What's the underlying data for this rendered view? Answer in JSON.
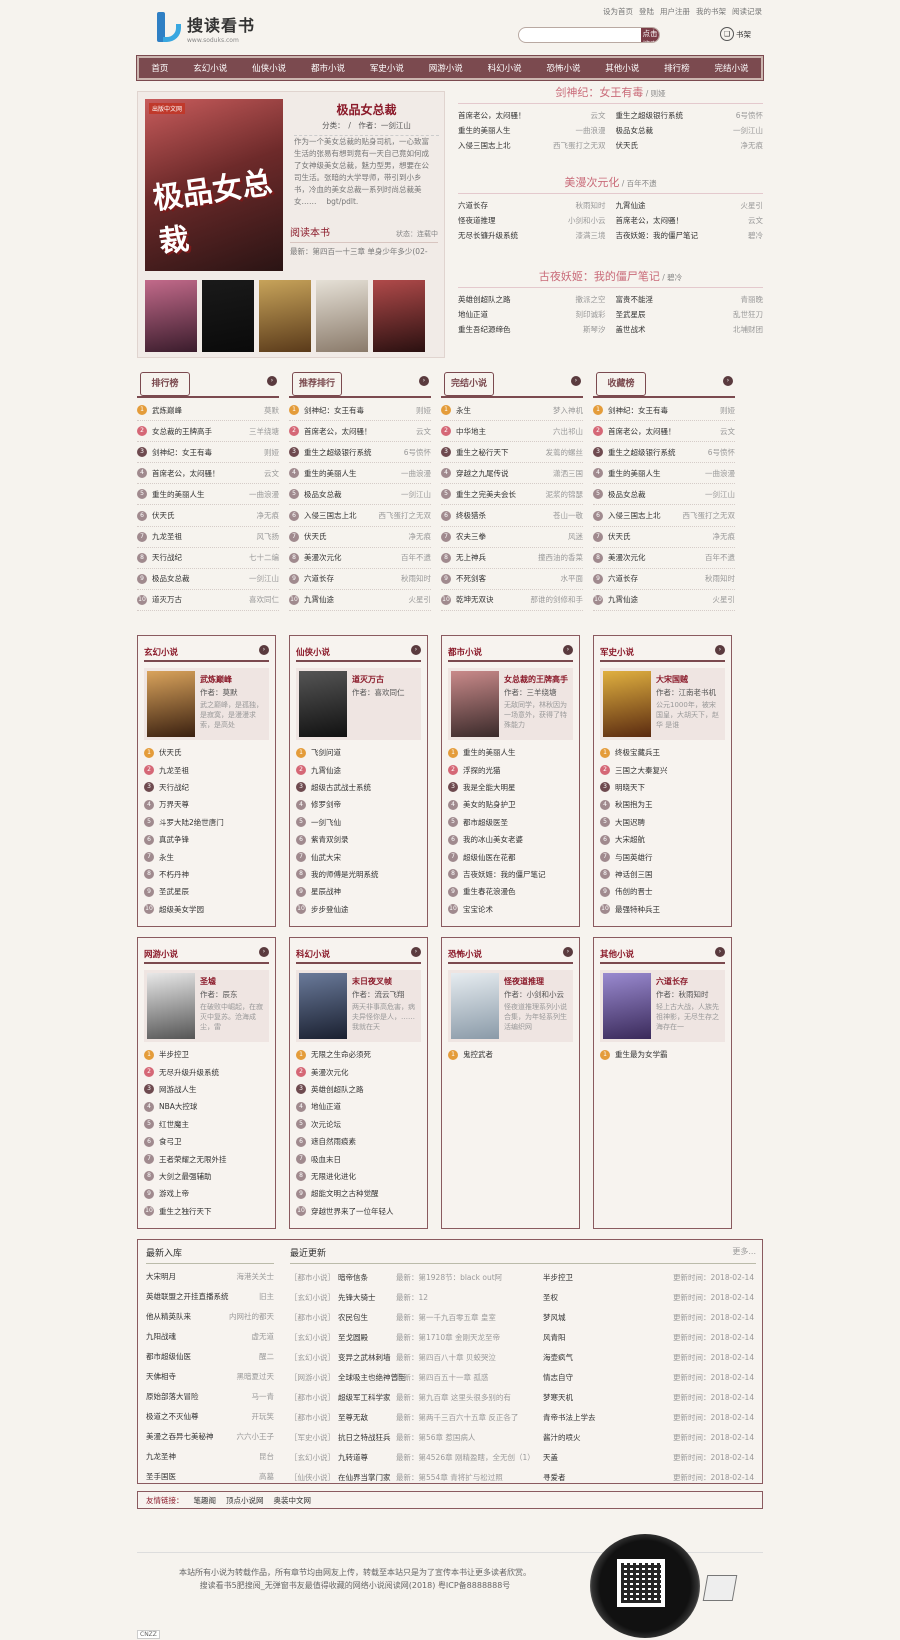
{
  "header": {
    "logo_title": "搜读看书",
    "logo_url_text": "www.soduks.com",
    "top_links": [
      "设为首页",
      "登陆",
      "用户注册",
      "我的书架",
      "阅读记录"
    ],
    "search_placeholder": "",
    "search_button": "点击搜索",
    "shelf_label": "书架"
  },
  "nav": [
    "首页",
    "玄幻小说",
    "仙侠小说",
    "都市小说",
    "军史小说",
    "网游小说",
    "科幻小说",
    "恐怖小说",
    "其他小说",
    "排行榜",
    "完结小说"
  ],
  "feature": {
    "cover_title": "极品女总裁",
    "cover_badge": "出版中文网",
    "title": "极品女总裁",
    "meta": "分类：　/　作者：一剑江山",
    "desc": "作为一个美女总裁的贴身司机，一心致富生活的张易有想到竟有一天自己竟如何成了女神级美女总裁，魅力型男，想要在公司生活。张暗的大学导师，带引到小乡书，冷血的美女总裁一系列时尚总裁美女…… 　bgt/pdlt.",
    "read": "阅读本书",
    "status": "状态：连载中",
    "latest": "最新：第四百一十三章 单身少年多少(02-"
  },
  "thumbs": [
    {
      "c1": "#c26a8a",
      "c2": "#3a1c2c"
    },
    {
      "c1": "#1a1a1a",
      "c2": "#0a0a0a"
    },
    {
      "c1": "#c7a35a",
      "c2": "#5a3a1a"
    },
    {
      "c1": "#e5e0d6",
      "c2": "#8a7a6a"
    },
    {
      "c1": "#b04a4a",
      "c2": "#2a1010"
    }
  ],
  "rec": [
    {
      "title": "剑神纪：女王有毒",
      "author": "则娅",
      "items": [
        [
          "首席老公，太闷骚！",
          "云文"
        ],
        [
          "重生之超级银行系统",
          "6号愤怀"
        ],
        [
          "重生的美丽人生",
          "一曲浪漫"
        ],
        [
          "极品女总裁",
          "一剑江山"
        ],
        [
          "入侵三国志上北",
          "西飞蛋打之无双"
        ],
        [
          "伏天氏",
          "净无痕"
        ]
      ]
    },
    {
      "title": "美漫次元化",
      "author": "百年不遗",
      "items": [
        [
          "六道长存",
          "秋雨知时"
        ],
        [
          "九霄仙途",
          "火星引"
        ],
        [
          "怪夜道推理",
          "小剑和小云"
        ],
        [
          "首席老公，太闷骚！",
          "云文"
        ],
        [
          "无尽长镰升级系统",
          "漆满三境"
        ],
        [
          "吉夜妖姬：我的僵尸笔记",
          "碧冷"
        ]
      ]
    },
    {
      "title": "古夜妖姬：我的僵尸笔记",
      "author": "碧冷",
      "items": [
        [
          "英雄创超队之路",
          "撒派之空"
        ],
        [
          "富贵不能淫",
          "青丽晚"
        ],
        [
          "地仙正道",
          "刻印诚彩"
        ],
        [
          "圣武星辰",
          "乱世狂刀"
        ],
        [
          "重生吾纪源缔色",
          "斯琴汐"
        ],
        [
          "盖世战术",
          "北埔财团"
        ]
      ]
    }
  ],
  "ranks": [
    {
      "title": "排行榜",
      "items": [
        [
          "武炼巅峰",
          "莫默"
        ],
        [
          "女总裁的王牌高手",
          "三羊绕塘"
        ],
        [
          "剑神纪：女王有毒",
          "则娅"
        ],
        [
          "首席老公，太闷骚！",
          "云文"
        ],
        [
          "重生的美丽人生",
          "一曲浪漫"
        ],
        [
          "伏天氏",
          "净无痕"
        ],
        [
          "九龙圣祖",
          "风飞扬"
        ],
        [
          "天行战纪",
          "七十二编"
        ],
        [
          "极品女总裁",
          "一剑江山"
        ],
        [
          "道灭万古",
          "喜欢同仁"
        ]
      ]
    },
    {
      "title": "推荐排行",
      "items": [
        [
          "剑神纪：女王有毒",
          "则娅"
        ],
        [
          "首席老公，太闷骚！",
          "云文"
        ],
        [
          "重生之超级银行系统",
          "6号愤怀"
        ],
        [
          "重生的美丽人生",
          "一曲浪漫"
        ],
        [
          "极品女总裁",
          "一剑江山"
        ],
        [
          "入侵三国志上北",
          "西飞蛋打之无双"
        ],
        [
          "伏天氏",
          "净无痕"
        ],
        [
          "美漫次元化",
          "百年不遗"
        ],
        [
          "六道长存",
          "秋雨知时"
        ],
        [
          "九霄仙途",
          "火星引"
        ]
      ]
    },
    {
      "title": "完结小说",
      "items": [
        [
          "永生",
          "梦入神机"
        ],
        [
          "中华地主",
          "六出祁山"
        ],
        [
          "重生之秘行天下",
          "发蔫的螺丝"
        ],
        [
          "穿越之九尾传说",
          "潇洒三国"
        ],
        [
          "重生之完美夫会长",
          "泥浆的锦瑟"
        ],
        [
          "终极猎杀",
          "苍山一敬"
        ],
        [
          "农夫三拳",
          "风迷"
        ],
        [
          "无上神兵",
          "撞西油的香菜"
        ],
        [
          "不死剑客",
          "水平面"
        ],
        [
          "乾坤无双诀",
          "那谁的剑修和手"
        ]
      ]
    },
    {
      "title": "收藏榜",
      "items": [
        [
          "剑神纪：女王有毒",
          "则娅"
        ],
        [
          "首席老公，太闷骚！",
          "云文"
        ],
        [
          "重生之超级银行系统",
          "6号愤怀"
        ],
        [
          "重生的美丽人生",
          "一曲浪漫"
        ],
        [
          "极品女总裁",
          "一剑江山"
        ],
        [
          "入侵三国志上北",
          "西飞蛋打之无双"
        ],
        [
          "伏天氏",
          "净无痕"
        ],
        [
          "美漫次元化",
          "百年不遗"
        ],
        [
          "六道长存",
          "秋雨知时"
        ],
        [
          "九霄仙途",
          "火星引"
        ]
      ]
    }
  ],
  "cats": [
    {
      "title": "玄幻小说",
      "top": {
        "name": "武炼巅峰",
        "author": "作者：莫默",
        "desc": "武之巅峰，是孤独，是寂寞，是漫漫求索，是高处",
        "c1": "#d9a35c",
        "c2": "#3a2010"
      },
      "items": [
        "伏天氏",
        "九龙圣祖",
        "天行战纪",
        "万界天尊",
        "斗罗大陆2绝世唐门",
        "真武争锋",
        "永生",
        "不朽丹神",
        "圣武星辰",
        "超级美女学园"
      ]
    },
    {
      "title": "仙侠小说",
      "top": {
        "name": "道灭万古",
        "author": "作者：喜欢同仁",
        "desc": "",
        "c1": "#555",
        "c2": "#111"
      },
      "items": [
        "飞剑问道",
        "九霄仙途",
        "超级古武战士系统",
        "修罗剑帝",
        "一剑飞仙",
        "紫青双剑录",
        "仙武大宋",
        "我的师傅是光明系统",
        "星辰战神",
        "步步登仙途"
      ]
    },
    {
      "title": "都市小说",
      "top": {
        "name": "女总裁的王牌高手",
        "author": "作者：三羊绕塘",
        "desc": "无敌同学，林秋因为一场意外，获得了特殊能力",
        "c1": "#c98a8a",
        "c2": "#3a2a2a"
      },
      "items": [
        "重生的美丽人生",
        "浮探的光猫",
        "我是全能大明星",
        "美女的贴身护卫",
        "都市超级医圣",
        "我的冰山美女老婆",
        "超级仙医在花都",
        "吉夜妖姬：我的僵尸笔记",
        "重生春花浪漫色",
        "宝宝论术"
      ]
    },
    {
      "title": "军史小说",
      "top": {
        "name": "大宋国贼",
        "author": "作者：江南老书机",
        "desc": "公元1000年，被宋国皇，大胡天下，赵华 是谁",
        "c1": "#e0b040",
        "c2": "#5a2a10"
      },
      "items": [
        "终极宝藏兵王",
        "三国之大秦复兴",
        "明晓天下",
        "秋国抱为王",
        "大国迟聘",
        "大宋超航",
        "与国英雄行",
        "神话创三国",
        "伟创的晋士",
        "最强特种兵王"
      ]
    },
    {
      "title": "网游小说",
      "top": {
        "name": "圣墟",
        "author": "作者：辰东",
        "desc": "在破败中崛起，在寂灭中复苏。沧海成尘，雷",
        "c1": "#e8e8e8",
        "c2": "#555"
      },
      "items": [
        "半步控卫",
        "无尽升级升级系统",
        "网游战人生",
        "NBA大控球",
        "红世魔主",
        "食弓卫",
        "王者荣耀之无限外挂",
        "大剑之最强辅助",
        "游戏上帝",
        "重生之独行天下"
      ]
    },
    {
      "title": "科幻小说",
      "top": {
        "name": "末日夜叉帧",
        "author": "作者：流云飞翔",
        "desc": "两天非事高危害，病夫异怪你是人，……我就在天",
        "c1": "#6a7a9a",
        "c2": "#1a2030"
      },
      "items": [
        "无限之生命必须死",
        "美漫次元化",
        "英雄创超队之路",
        "地仙正道",
        "次元论坛",
        "遮自然雨痕素",
        "吸血末日",
        "无限进化进化",
        "超能文明之古种觉醒",
        "穿越世界来了一位年轻人"
      ]
    },
    {
      "title": "恐怖小说",
      "top": {
        "name": "怪夜道推理",
        "author": "作者：小剑和小云",
        "desc": "怪夜道推理系列小说合集，为年轻系列生活编织网",
        "c1": "#e6ecf0",
        "c2": "#8a9aa8"
      },
      "items": [
        "鬼控武者"
      ]
    },
    {
      "title": "其他小说",
      "top": {
        "name": "六道长存",
        "author": "作者：秋雨知时",
        "desc": "轻上古大战，人族先祖神影，无尽生存之海存在一",
        "c1": "#9a8ad0",
        "c2": "#3a2a5a"
      },
      "items": [
        "重生最为女学霸"
      ]
    }
  ],
  "latest_in": {
    "title": "最新入库",
    "items": [
      [
        "大宋明月",
        "海港关关士"
      ],
      [
        "英雄联盟之开挂直播系统",
        "旧主"
      ],
      [
        "他从精英队来",
        "内网社的都天"
      ],
      [
        "九阳战魂",
        "虚无道"
      ],
      [
        "都市超级仙医",
        "醒二"
      ],
      [
        "天佛相寺",
        "黑暗夏过天"
      ],
      [
        "原始部落大冒险",
        "马一青"
      ],
      [
        "极道之不灭仙尊",
        "开玩笑"
      ],
      [
        "美漫之吞异七美秘神",
        "六六小王子"
      ],
      [
        "九龙圣神",
        "昆台"
      ],
      [
        "圣手国医",
        "高墓"
      ]
    ]
  },
  "updates": {
    "title": "最近更新",
    "more": "更多...",
    "rows": [
      [
        "［都市小说］",
        "暗帝信条",
        "最新：第1928节：black out阿",
        "半步控卫",
        "更新时间：2018-02-14"
      ],
      [
        "［玄幻小说］",
        "先锋大骑士",
        "最新：12",
        "圣权",
        "更新时间：2018-02-14"
      ],
      [
        "［都市小说］",
        "农民包生",
        "最新：第一千九百零五章 皇室",
        "梦风城",
        "更新时间：2018-02-14"
      ],
      [
        "［玄幻小说］",
        "至戈圆殿",
        "最新：第1710章 金刚天龙至帝",
        "风青阳",
        "更新时间：2018-02-14"
      ],
      [
        "［玄幻小说］",
        "变异之武林刺墙",
        "最新：第四百八十章 贝蛟哭泣",
        "海壶疯气",
        "更新时间：2018-02-14"
      ],
      [
        "［网游小说］",
        "全球吸主也绝神曾臣",
        "最新：第四百五十一章 孤惑",
        "情志自守",
        "更新时间：2018-02-14"
      ],
      [
        "［都市小说］",
        "超级军工科学家",
        "最新：第九百章 这里头很多别的有",
        "梦寒天机",
        "更新时间：2018-02-14"
      ],
      [
        "［都市小说］",
        "至尊无敌",
        "最新：第两千三百六十五章 反正各了",
        "青帝书法上学去",
        "更新时间：2018-02-14"
      ],
      [
        "［军史小说］",
        "抗日之特战狂兵",
        "最新：第56章 惹国病人",
        "酱汁的喷火",
        "更新时间：2018-02-14"
      ],
      [
        "［玄幻小说］",
        "九转道尊",
        "最新：第4526章 刚精盈瞎，全无创（1）",
        "天盖",
        "更新时间：2018-02-14"
      ],
      [
        "［仙侠小说］",
        "在仙界当掌门家",
        "最新：第554章 青将扩与松过照",
        "寻爱者",
        "更新时间：2018-02-14"
      ]
    ]
  },
  "friend_links": {
    "label": "友情链接：",
    "items": [
      "笔趣阁",
      "顶点小说网",
      "奥装中文网"
    ]
  },
  "footer": {
    "line1": "本站所有小说为转载作品，所有章节均由网友上传，转载至本站只是为了宣传本书让更多读者欣赏。",
    "line2": "搜读看书5肥搜阅_无弹窗书友最值得收藏的网络小说阅读网(2018) 粤ICP备8888888号",
    "cnzz": "CNZZ"
  }
}
